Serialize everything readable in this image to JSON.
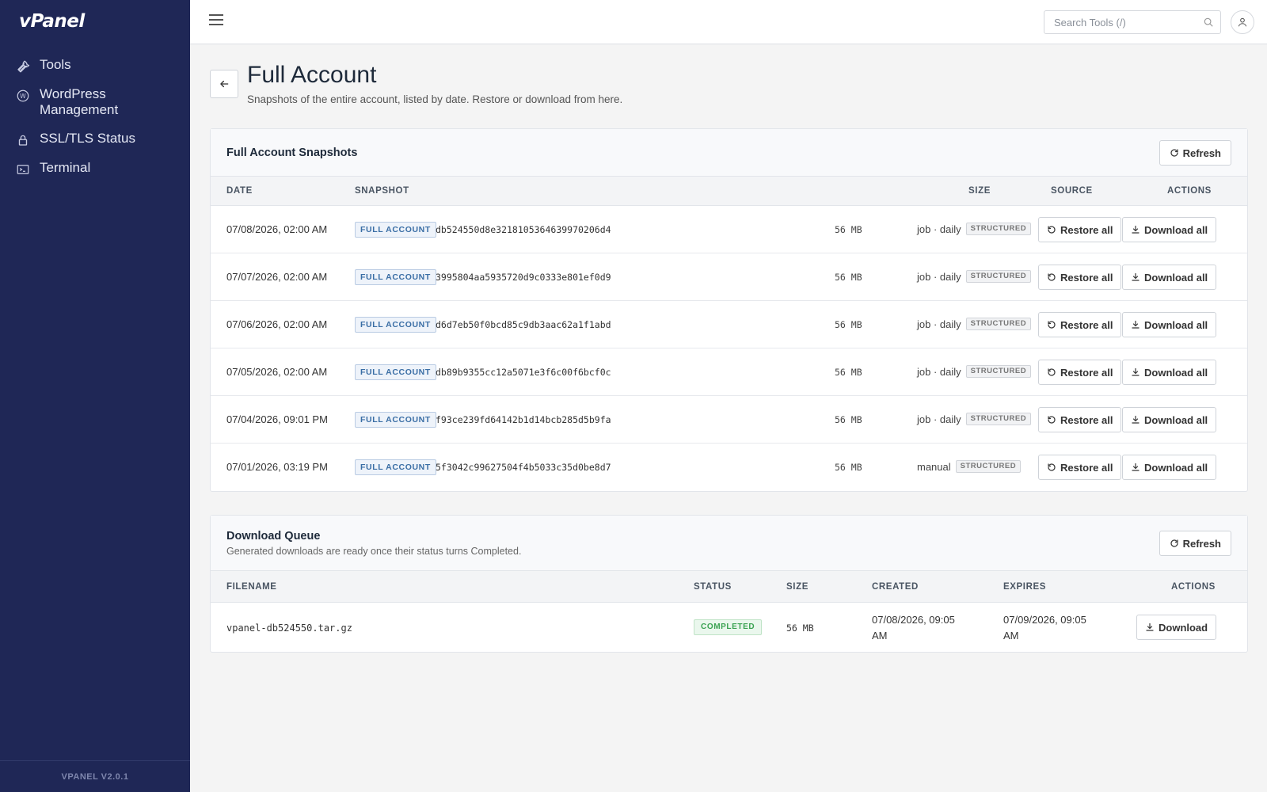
{
  "app": {
    "logo": "vPanel",
    "version": "VPANEL V2.0.1"
  },
  "sidebar": {
    "items": [
      {
        "label": "Tools",
        "icon": "wrench-icon"
      },
      {
        "label": "WordPress Management",
        "icon": "wordpress-icon"
      },
      {
        "label": "SSL/TLS Status",
        "icon": "lock-icon"
      },
      {
        "label": "Terminal",
        "icon": "terminal-icon"
      }
    ]
  },
  "topbar": {
    "search_placeholder": "Search Tools (/)"
  },
  "page": {
    "title": "Full Account",
    "subtitle": "Snapshots of the entire account, listed by date. Restore or download from here."
  },
  "snapshots": {
    "title": "Full Account Snapshots",
    "refresh_label": "Refresh",
    "columns": {
      "date": "DATE",
      "snapshot": "SNAPSHOT",
      "size": "SIZE",
      "source": "SOURCE",
      "actions": "ACTIONS"
    },
    "restore_label": "Restore all",
    "download_label": "Download all",
    "rows": [
      {
        "date": "07/08/2026, 02:00 AM",
        "type": "FULL ACCOUNT",
        "hash": "db524550d8e3218105364639970206d4",
        "size": "56 MB",
        "source": "job · daily",
        "format": "STRUCTURED"
      },
      {
        "date": "07/07/2026, 02:00 AM",
        "type": "FULL ACCOUNT",
        "hash": "3995804aa5935720d9c0333e801ef0d9",
        "size": "56 MB",
        "source": "job · daily",
        "format": "STRUCTURED"
      },
      {
        "date": "07/06/2026, 02:00 AM",
        "type": "FULL ACCOUNT",
        "hash": "d6d7eb50f0bcd85c9db3aac62a1f1abd",
        "size": "56 MB",
        "source": "job · daily",
        "format": "STRUCTURED"
      },
      {
        "date": "07/05/2026, 02:00 AM",
        "type": "FULL ACCOUNT",
        "hash": "db89b9355cc12a5071e3f6c00f6bcf0c",
        "size": "56 MB",
        "source": "job · daily",
        "format": "STRUCTURED"
      },
      {
        "date": "07/04/2026, 09:01 PM",
        "type": "FULL ACCOUNT",
        "hash": "f93ce239fd64142b1d14bcb285d5b9fa",
        "size": "56 MB",
        "source": "job · daily",
        "format": "STRUCTURED"
      },
      {
        "date": "07/01/2026, 03:19 PM",
        "type": "FULL ACCOUNT",
        "hash": "5f3042c99627504f4b5033c35d0be8d7",
        "size": "56 MB",
        "source": "manual",
        "format": "STRUCTURED"
      }
    ]
  },
  "queue": {
    "title": "Download Queue",
    "subtitle": "Generated downloads are ready once their status turns Completed.",
    "refresh_label": "Refresh",
    "columns": {
      "filename": "FILENAME",
      "status": "STATUS",
      "size": "SIZE",
      "created": "CREATED",
      "expires": "EXPIRES",
      "actions": "ACTIONS"
    },
    "rows": [
      {
        "filename": "vpanel-db524550.tar.gz",
        "status": "COMPLETED",
        "size": "56 MB",
        "created_line1": "07/08/2026, 09:05",
        "created_line2": "AM",
        "expires_line1": "07/09/2026, 09:05",
        "expires_line2": "AM",
        "action": "Download"
      }
    ]
  },
  "colors": {
    "sidebar_bg": "#1f2756",
    "badge_blue": "#3a6ea5",
    "status_green": "#3aa251"
  }
}
